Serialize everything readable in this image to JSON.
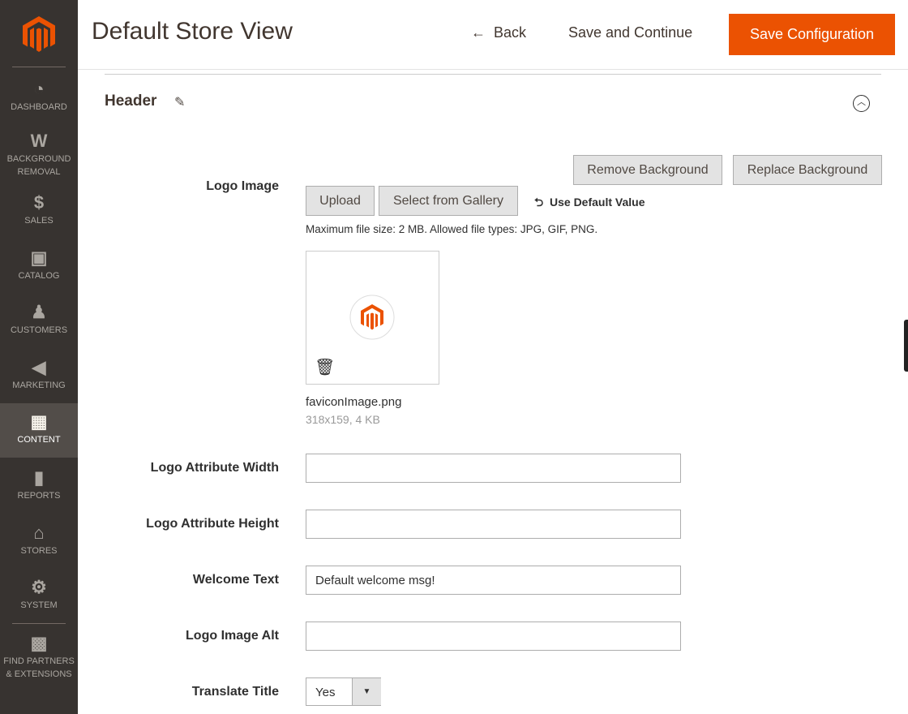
{
  "sidebar": {
    "items": [
      {
        "label": "DASHBOARD",
        "icon": "dashboard-icon"
      },
      {
        "label": "BACKGROUND REMOVAL",
        "icon": "w-logo-icon"
      },
      {
        "label": "SALES",
        "icon": "dollar-icon"
      },
      {
        "label": "CATALOG",
        "icon": "box-icon"
      },
      {
        "label": "CUSTOMERS",
        "icon": "person-icon"
      },
      {
        "label": "MARKETING",
        "icon": "megaphone-icon"
      },
      {
        "label": "CONTENT",
        "icon": "layout-icon",
        "active": true
      },
      {
        "label": "REPORTS",
        "icon": "bar-chart-icon"
      },
      {
        "label": "STORES",
        "icon": "storefront-icon"
      },
      {
        "label": "SYSTEM",
        "icon": "gear-icon"
      },
      {
        "label": "FIND PARTNERS & EXTENSIONS",
        "icon": "lego-brick-icon"
      }
    ]
  },
  "header": {
    "title": "Default Store View",
    "back": "Back",
    "save_continue": "Save and Continue",
    "save_config": "Save Configuration"
  },
  "section": {
    "title": "Header"
  },
  "logo": {
    "label": "Logo Image",
    "remove_bg": "Remove Background",
    "replace_bg": "Replace Background",
    "upload": "Upload",
    "gallery": "Select from Gallery",
    "use_default": "Use Default Value",
    "note": "Maximum file size: 2 MB. Allowed file types: JPG, GIF, PNG.",
    "file_name": "faviconImage.png",
    "file_meta": "318x159, 4 KB"
  },
  "fields": {
    "width": {
      "label": "Logo Attribute Width",
      "value": ""
    },
    "height": {
      "label": "Logo Attribute Height",
      "value": ""
    },
    "welcome": {
      "label": "Welcome Text",
      "value": "Default welcome msg!"
    },
    "alt": {
      "label": "Logo Image Alt",
      "value": ""
    },
    "translate": {
      "label": "Translate Title",
      "value": "Yes"
    }
  },
  "colors": {
    "accent": "#eb5202",
    "sidebar": "#373330"
  }
}
